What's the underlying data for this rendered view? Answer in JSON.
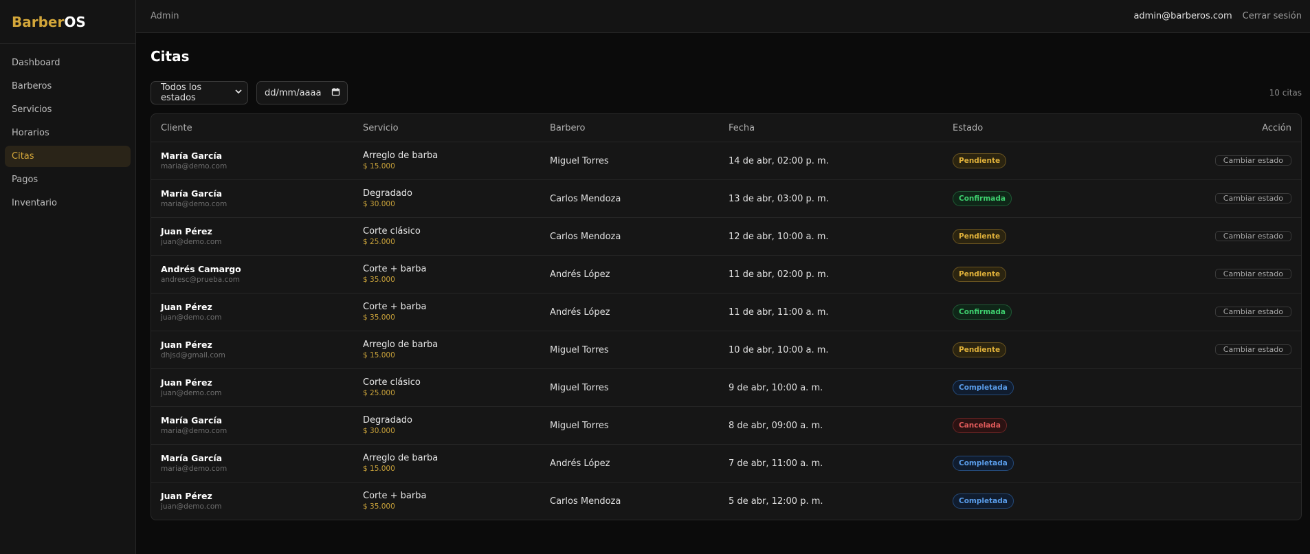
{
  "brand": {
    "part1": "Barber",
    "part2": "OS"
  },
  "nav": [
    {
      "label": "Dashboard",
      "active": false
    },
    {
      "label": "Barberos",
      "active": false
    },
    {
      "label": "Servicios",
      "active": false
    },
    {
      "label": "Horarios",
      "active": false
    },
    {
      "label": "Citas",
      "active": true
    },
    {
      "label": "Pagos",
      "active": false
    },
    {
      "label": "Inventario",
      "active": false
    }
  ],
  "topbar": {
    "role": "Admin",
    "email": "admin@barberos.com",
    "logout": "Cerrar sesión"
  },
  "page": {
    "title": "Citas",
    "count": "10 citas"
  },
  "filters": {
    "status_selected": "Todos los estados",
    "date_placeholder": "dd/mm/aaaa"
  },
  "table": {
    "headers": [
      "Cliente",
      "Servicio",
      "Barbero",
      "Fecha",
      "Estado",
      "Acción"
    ],
    "rows": [
      {
        "client": "María García",
        "email": "maria@demo.com",
        "service": "Arreglo de barba",
        "price": "$ 15.000",
        "barber": "Miguel Torres",
        "date": "14 de abr, 02:00 p. m.",
        "status": "Pendiente",
        "status_key": "pendiente",
        "action": "Cambiar estado"
      },
      {
        "client": "María García",
        "email": "maria@demo.com",
        "service": "Degradado",
        "price": "$ 30.000",
        "barber": "Carlos Mendoza",
        "date": "13 de abr, 03:00 p. m.",
        "status": "Confirmada",
        "status_key": "confirmada",
        "action": "Cambiar estado"
      },
      {
        "client": "Juan Pérez",
        "email": "juan@demo.com",
        "service": "Corte clásico",
        "price": "$ 25.000",
        "barber": "Carlos Mendoza",
        "date": "12 de abr, 10:00 a. m.",
        "status": "Pendiente",
        "status_key": "pendiente",
        "action": "Cambiar estado"
      },
      {
        "client": "Andrés Camargo",
        "email": "andresc@prueba.com",
        "service": "Corte + barba",
        "price": "$ 35.000",
        "barber": "Andrés López",
        "date": "11 de abr, 02:00 p. m.",
        "status": "Pendiente",
        "status_key": "pendiente",
        "action": "Cambiar estado"
      },
      {
        "client": "Juan Pérez",
        "email": "juan@demo.com",
        "service": "Corte + barba",
        "price": "$ 35.000",
        "barber": "Andrés López",
        "date": "11 de abr, 11:00 a. m.",
        "status": "Confirmada",
        "status_key": "confirmada",
        "action": "Cambiar estado"
      },
      {
        "client": "Juan Pérez",
        "email": "dhjsd@gmail.com",
        "service": "Arreglo de barba",
        "price": "$ 15.000",
        "barber": "Miguel Torres",
        "date": "10 de abr, 10:00 a. m.",
        "status": "Pendiente",
        "status_key": "pendiente",
        "action": "Cambiar estado"
      },
      {
        "client": "Juan Pérez",
        "email": "juan@demo.com",
        "service": "Corte clásico",
        "price": "$ 25.000",
        "barber": "Miguel Torres",
        "date": "9 de abr, 10:00 a. m.",
        "status": "Completada",
        "status_key": "completada",
        "action": ""
      },
      {
        "client": "María García",
        "email": "maria@demo.com",
        "service": "Degradado",
        "price": "$ 30.000",
        "barber": "Miguel Torres",
        "date": "8 de abr, 09:00 a. m.",
        "status": "Cancelada",
        "status_key": "cancelada",
        "action": ""
      },
      {
        "client": "María García",
        "email": "maria@demo.com",
        "service": "Arreglo de barba",
        "price": "$ 15.000",
        "barber": "Andrés López",
        "date": "7 de abr, 11:00 a. m.",
        "status": "Completada",
        "status_key": "completada",
        "action": ""
      },
      {
        "client": "Juan Pérez",
        "email": "juan@demo.com",
        "service": "Corte + barba",
        "price": "$ 35.000",
        "barber": "Carlos Mendoza",
        "date": "5 de abr, 12:00 p. m.",
        "status": "Completada",
        "status_key": "completada",
        "action": ""
      }
    ]
  },
  "colors": {
    "accent": "#d4a73a",
    "background": "#0b0b0b",
    "panel": "#141414"
  },
  "icons": {
    "select_arrow": "chevron-down-icon",
    "date_picker": "calendar-icon"
  }
}
